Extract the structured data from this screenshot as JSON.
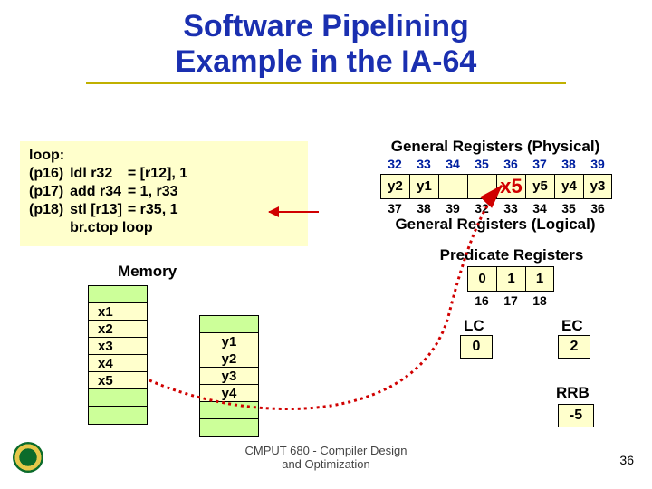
{
  "title_line1": "Software Pipelining",
  "title_line2": "Example in the IA-64",
  "code": {
    "l0c0": "loop:",
    "l1c0": "(p16)",
    "l1c1": "ldl r32",
    "l1c2": "= [r12], 1",
    "l2c0": "(p17)",
    "l2c1": "add r34",
    "l2c2": "= 1, r33",
    "l3c0": "(p18)",
    "l3c1": "stl [r13]",
    "l3c2": "= r35, 1",
    "l4c1": "br.ctop loop"
  },
  "mem_label": "Memory",
  "mem_x": [
    "x1",
    "x2",
    "x3",
    "x4",
    "x5"
  ],
  "mem_y": [
    "y1",
    "y2",
    "y3",
    "y4"
  ],
  "genreg_phys_hdr": "General Registers (Physical)",
  "genreg_log_hdr": "General Registers (Logical)",
  "phys_nums": [
    "32",
    "33",
    "34",
    "35",
    "36",
    "37",
    "38",
    "39"
  ],
  "log_nums": [
    "37",
    "38",
    "39",
    "32",
    "33",
    "34",
    "35",
    "36"
  ],
  "genreg_vals": [
    "y2",
    "y1",
    "",
    "",
    "x5",
    "y5",
    "y4",
    "y3"
  ],
  "pred_hdr": "Predicate Registers",
  "pred_vals": [
    "0",
    "1",
    "1"
  ],
  "pred_nums": [
    "16",
    "17",
    "18"
  ],
  "lc_label": "LC",
  "lc_val": "0",
  "ec_label": "EC",
  "ec_val": "2",
  "rrb_label": "RRB",
  "rrb_val": "-5",
  "footer1": "CMPUT 680 - Compiler Design",
  "footer2": "and Optimization",
  "pagenum": "36"
}
